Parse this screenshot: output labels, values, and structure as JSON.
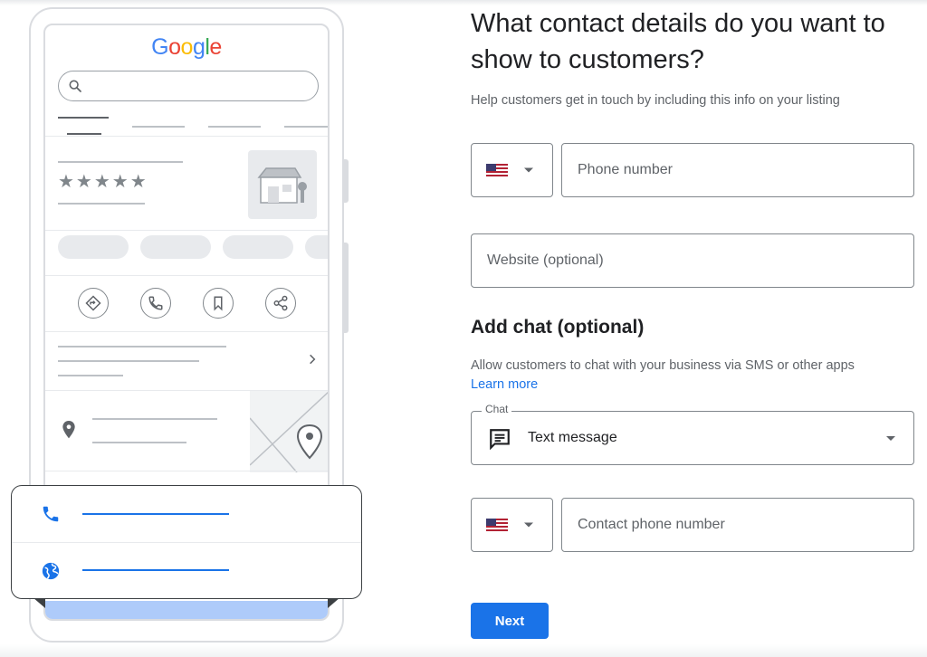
{
  "illustration": {
    "logo_text": [
      "G",
      "o",
      "o",
      "g",
      "l",
      "e"
    ],
    "rating_stars": "★★★★★",
    "icons": [
      "search-icon",
      "store-icon",
      "directions-icon",
      "phone-icon",
      "bookmark-icon",
      "share-icon",
      "chevron-right-icon",
      "location-pin-icon",
      "globe-icon"
    ],
    "accent_color": "#1a73e8"
  },
  "form": {
    "title": "What contact details do you want to show to customers?",
    "help_text": "Help customers get in touch by including this info on your listing",
    "phone": {
      "country_flag": "us-flag-icon",
      "placeholder": "Phone number"
    },
    "website": {
      "placeholder": "Website (optional)"
    },
    "chat_section": {
      "heading": "Add chat (optional)",
      "description": "Allow customers to chat with your business via SMS or other apps",
      "learn_more": "Learn more",
      "select_label": "Chat",
      "selected_value": "Text message",
      "contact_phone_placeholder": "Contact phone number"
    },
    "next_button": "Next"
  }
}
